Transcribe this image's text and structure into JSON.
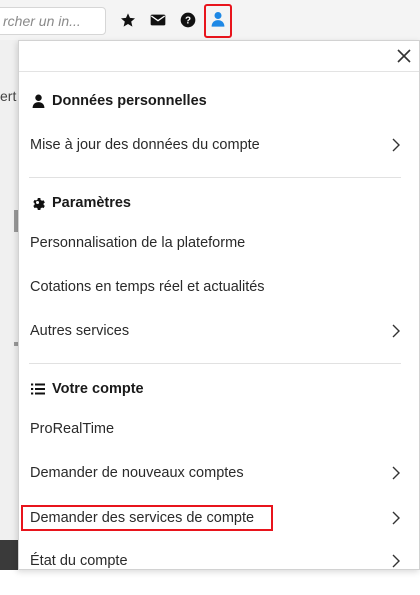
{
  "toolbar": {
    "search_placeholder": "rcher un in...",
    "icons": [
      "star-icon",
      "mail-icon",
      "help-icon",
      "user-icon"
    ]
  },
  "background": {
    "left_text": "ert"
  },
  "menu": {
    "sections": [
      {
        "title": "Données personnelles",
        "icon": "person-icon",
        "items": [
          {
            "label": "Mise à jour des données du compte",
            "has_chevron": true
          }
        ]
      },
      {
        "title": "Paramètres",
        "icon": "gear-icon",
        "items": [
          {
            "label": "Personnalisation de la plateforme",
            "has_chevron": false
          },
          {
            "label": "Cotations en temps réel et actualités",
            "has_chevron": false
          },
          {
            "label": "Autres services",
            "has_chevron": true
          }
        ]
      },
      {
        "title": "Votre compte",
        "icon": "list-icon",
        "items": [
          {
            "label": "ProRealTime",
            "has_chevron": false
          },
          {
            "label": "Demander de nouveaux comptes",
            "has_chevron": true
          },
          {
            "label": "Demander des services de compte",
            "has_chevron": true,
            "highlighted": true
          },
          {
            "label": "État du compte",
            "has_chevron": true
          }
        ]
      }
    ]
  },
  "colors": {
    "accent_red": "#e8141c",
    "user_icon_blue": "#1e88e5",
    "text": "#2a2a2a"
  }
}
